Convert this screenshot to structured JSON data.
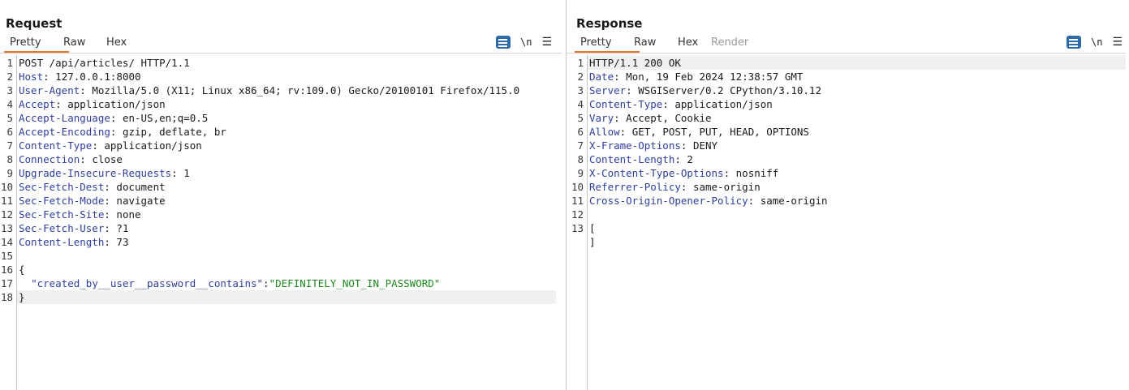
{
  "request": {
    "title": "Request",
    "tabs": [
      "Pretty",
      "Raw",
      "Hex"
    ],
    "active_tab": "Pretty",
    "newline_label": "\\n",
    "menu_glyph": "☰",
    "lines": [
      {
        "n": "1",
        "plain": "POST /api/articles/ HTTP/1.1"
      },
      {
        "n": "2",
        "key": "Host",
        "val": "127.0.0.1:8000"
      },
      {
        "n": "3",
        "key": "User-Agent",
        "val": "Mozilla/5.0 (X11; Linux x86_64; rv:109.0) Gecko/20100101 Firefox/115.0"
      },
      {
        "n": "4",
        "key": "Accept",
        "val": "application/json"
      },
      {
        "n": "5",
        "key": "Accept-Language",
        "val": "en-US,en;q=0.5"
      },
      {
        "n": "6",
        "key": "Accept-Encoding",
        "val": "gzip, deflate, br"
      },
      {
        "n": "7",
        "key": "Content-Type",
        "val": "application/json"
      },
      {
        "n": "8",
        "key": "Connection",
        "val": "close"
      },
      {
        "n": "9",
        "key": "Upgrade-Insecure-Requests",
        "val": "1"
      },
      {
        "n": "10",
        "key": "Sec-Fetch-Dest",
        "val": "document"
      },
      {
        "n": "11",
        "key": "Sec-Fetch-Mode",
        "val": "navigate"
      },
      {
        "n": "12",
        "key": "Sec-Fetch-Site",
        "val": "none"
      },
      {
        "n": "13",
        "key": "Sec-Fetch-User",
        "val": "?1"
      },
      {
        "n": "14",
        "key": "Content-Length",
        "val": "73"
      },
      {
        "n": "15",
        "plain": ""
      },
      {
        "n": "16",
        "plain": "{"
      },
      {
        "n": "17",
        "jkey": "\"created_by__user__password__contains\"",
        "jval": "\"DEFINITELY_NOT_IN_PASSWORD\""
      },
      {
        "n": "18",
        "plain": "}",
        "highlight": true
      }
    ]
  },
  "response": {
    "title": "Response",
    "tabs": [
      "Pretty",
      "Raw",
      "Hex",
      "Render"
    ],
    "active_tab": "Pretty",
    "disabled_tab": "Render",
    "newline_label": "\\n",
    "menu_glyph": "☰",
    "lines": [
      {
        "n": "1",
        "plain": "HTTP/1.1 200 OK",
        "highlight": true
      },
      {
        "n": "2",
        "key": "Date",
        "val": "Mon, 19 Feb 2024 12:38:57 GMT"
      },
      {
        "n": "3",
        "key": "Server",
        "val": "WSGIServer/0.2 CPython/3.10.12"
      },
      {
        "n": "4",
        "key": "Content-Type",
        "val": "application/json"
      },
      {
        "n": "5",
        "key": "Vary",
        "val": "Accept, Cookie"
      },
      {
        "n": "6",
        "key": "Allow",
        "val": "GET, POST, PUT, HEAD, OPTIONS"
      },
      {
        "n": "7",
        "key": "X-Frame-Options",
        "val": "DENY"
      },
      {
        "n": "8",
        "key": "Content-Length",
        "val": "2"
      },
      {
        "n": "9",
        "key": "X-Content-Type-Options",
        "val": "nosniff"
      },
      {
        "n": "10",
        "key": "Referrer-Policy",
        "val": "same-origin"
      },
      {
        "n": "11",
        "key": "Cross-Origin-Opener-Policy",
        "val": "same-origin"
      },
      {
        "n": "12",
        "plain": ""
      },
      {
        "n": "13",
        "plain": "["
      },
      {
        "n": "",
        "plain": "]"
      }
    ]
  },
  "colors": {
    "accent": "#2f6aa8",
    "tab_underline": "#e8742a",
    "header_key": "#2e3f9e",
    "json_string": "#1c8a1c"
  }
}
